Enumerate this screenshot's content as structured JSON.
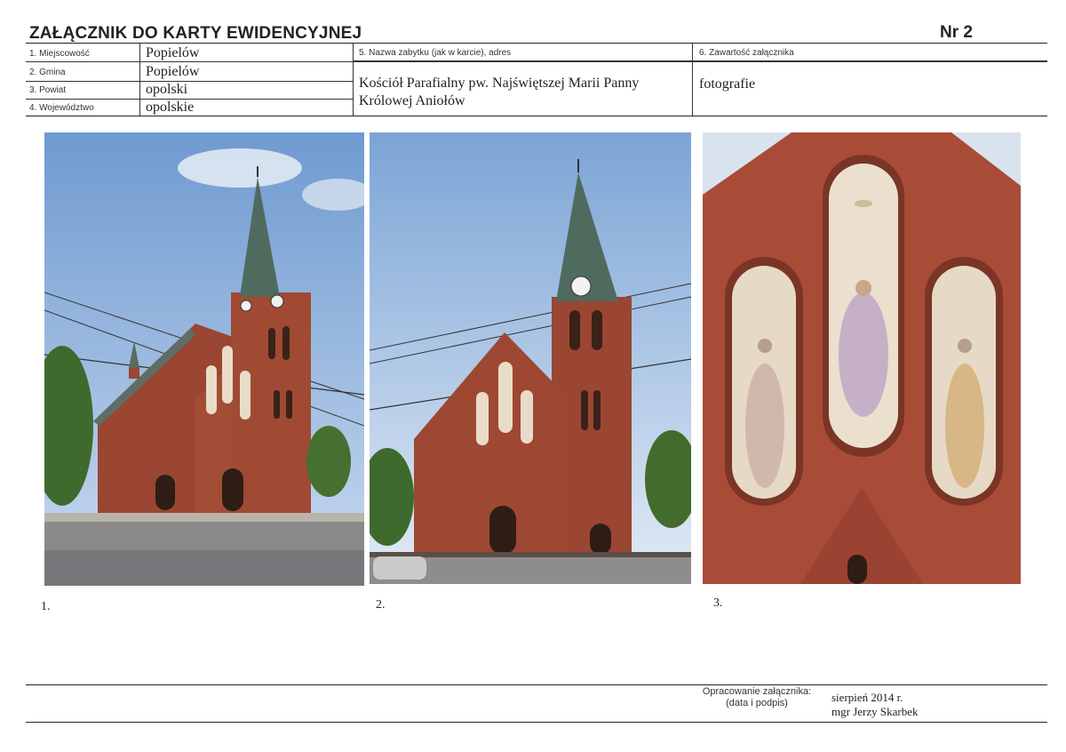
{
  "header": {
    "title": "ZAŁĄCZNIK DO KARTY EWIDENCYJNEJ",
    "number": "Nr 2"
  },
  "fields": {
    "miejscowosc": {
      "label": "1. Miejscowość",
      "value": "Popielów"
    },
    "gmina": {
      "label": "2. Gmina",
      "value": "Popielów"
    },
    "powiat": {
      "label": "3. Powiat",
      "value": "opolski"
    },
    "wojewodztwo": {
      "label": "4. Województwo",
      "value": "opolskie"
    },
    "nazwa": {
      "label": "5. Nazwa zabytku (jak w karcie), adres",
      "value_line1": "Kościół Parafialny pw. Najświętszej Marii Panny",
      "value_line2": "Królowej Aniołów"
    },
    "zawartosc": {
      "label": "6. Zawartość załącznika",
      "value": "fotografie"
    }
  },
  "photos": [
    {
      "caption": "1."
    },
    {
      "caption": "2."
    },
    {
      "caption": "3."
    }
  ],
  "footer": {
    "label_line1": "Opracowanie załącznika:",
    "label_line2": "(data i podpis)",
    "date": "sierpień  2014 r.",
    "author": "mgr Jerzy Skarbek"
  },
  "colors": {
    "sky": "#7fa6d6",
    "brick": "#9a4632",
    "roof": "#4f6b5e",
    "tree": "#3f6a2e",
    "road": "#8a8a8a"
  }
}
